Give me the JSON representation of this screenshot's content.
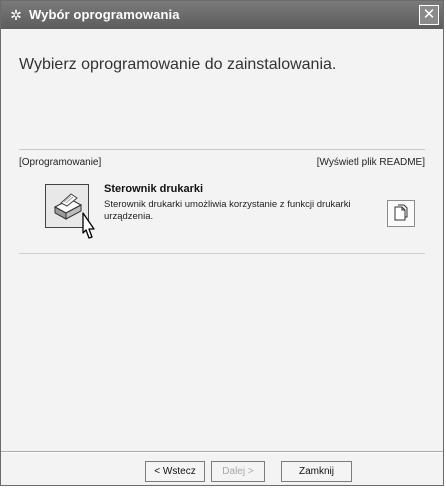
{
  "window": {
    "title": "Wybór oprogramowania"
  },
  "main": {
    "prompt": "Wybierz oprogramowanie do zainstalowania.",
    "header": {
      "software_label": "[Oprogramowanie]",
      "readme_label": "[Wyświetl plik README]"
    },
    "items": [
      {
        "title": "Sterownik drukarki",
        "description": "Sterownik drukarki umożliwia korzystanie z funkcji drukarki urządzenia.",
        "icon": "printer-icon"
      }
    ]
  },
  "footer": {
    "back_label": "< Wstecz",
    "next_label": "Dalej >",
    "close_label": "Zamknij"
  },
  "icons": {
    "app": "app-icon",
    "readme": "document-icon",
    "close": "close-icon"
  },
  "colors": {
    "titlebar": "#6a6a6a",
    "window_bg": "#f3f3f3"
  }
}
